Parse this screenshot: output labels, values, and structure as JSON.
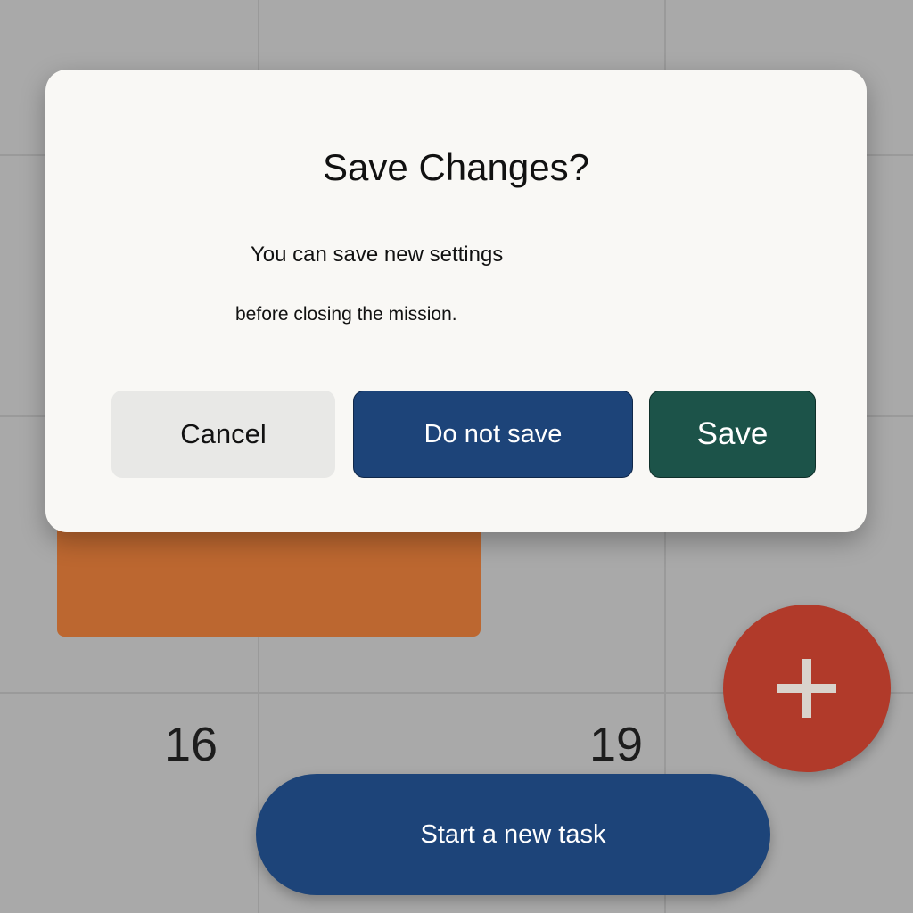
{
  "calendar": {
    "date_left": "16",
    "date_right": "19",
    "event_color": "#bc6730"
  },
  "fab": {
    "icon": "plus-icon",
    "color": "#b13a2a"
  },
  "new_task_button": {
    "label": "Start a new task",
    "color": "#1d4479"
  },
  "dialog": {
    "title": "Save Changes?",
    "message_line1": "You can save new settings",
    "message_line2": "before closing the mission.",
    "buttons": {
      "cancel": "Cancel",
      "dont_save": "Do not save",
      "save": "Save"
    },
    "colors": {
      "dont_save": "#1d4479",
      "save": "#1c5349"
    }
  }
}
